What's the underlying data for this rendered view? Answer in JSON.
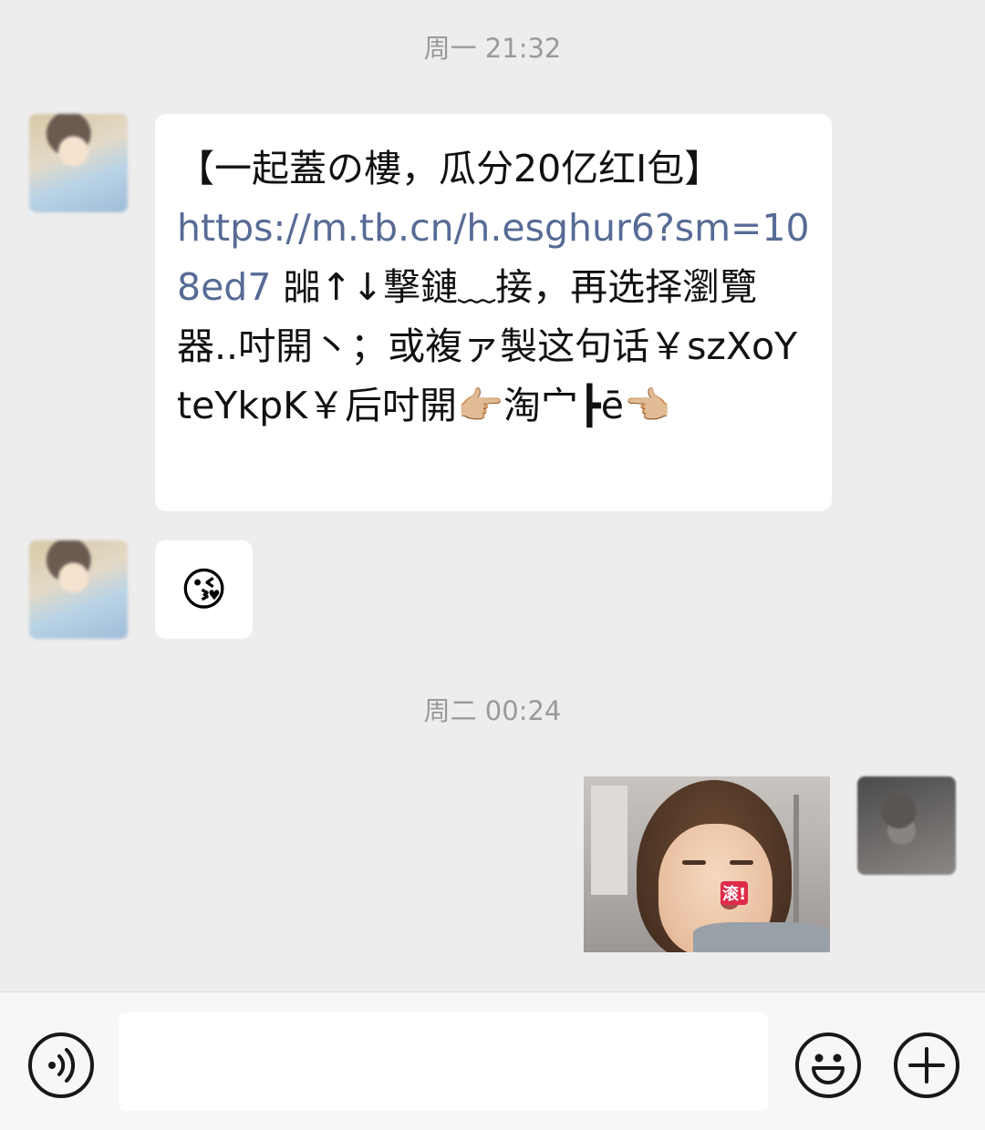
{
  "chat": {
    "timestamp_1": "周一 21:32",
    "timestamp_2": "周二 00:24",
    "message_1": {
      "line_1": "【一起蓋の樓，瓜分20亿红I包】",
      "link": "https://m.tb.cn/h.esghur6?sm=108ed7",
      "rest": " 嘂↑↓撃鏈﹏接，再选择瀏覽器..吋開丶；或複ァ製这句话￥szXoYteYkpK￥后吋開👉🏼淘宀┣ē👈🏼"
    },
    "message_2": {
      "emoji": "😘"
    },
    "message_3": {
      "sticker_caption": "滚!"
    }
  },
  "input_bar": {
    "input_value": "",
    "voice_icon": "voice-icon",
    "emoji_icon": "smiley-icon",
    "plus_icon": "plus-icon"
  },
  "colors": {
    "background": "#ededed",
    "bubble": "#ffffff",
    "link": "#576b95",
    "timestamp": "#9a9a9a"
  }
}
